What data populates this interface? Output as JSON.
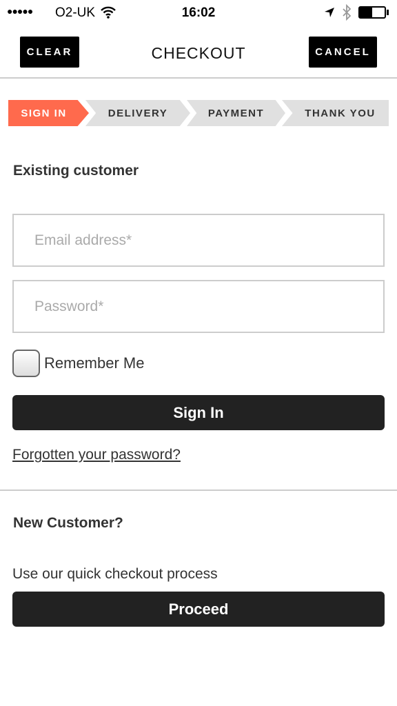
{
  "status_bar": {
    "carrier": "O2-UK",
    "time": "16:02",
    "signal_dots": 5,
    "battery_level": 0.5
  },
  "nav": {
    "clear_label": "CLEAR",
    "title": "CHECKOUT",
    "cancel_label": "CANCEL"
  },
  "steps": [
    {
      "label": "SIGN IN",
      "active": true
    },
    {
      "label": "DELIVERY"
    },
    {
      "label": "PAYMENT"
    },
    {
      "label": "THANK YOU"
    }
  ],
  "accent_color": "#ff6a4d",
  "existing": {
    "heading": "Existing customer",
    "email_placeholder": "Email address*",
    "password_placeholder": "Password*",
    "remember_label": "Remember Me",
    "remember_checked": false,
    "sign_in_label": "Sign In",
    "forgot_link": "Forgotten your password?"
  },
  "new_customer": {
    "heading": "New Customer?",
    "text": "Use our quick checkout process",
    "proceed_label": "Proceed"
  }
}
